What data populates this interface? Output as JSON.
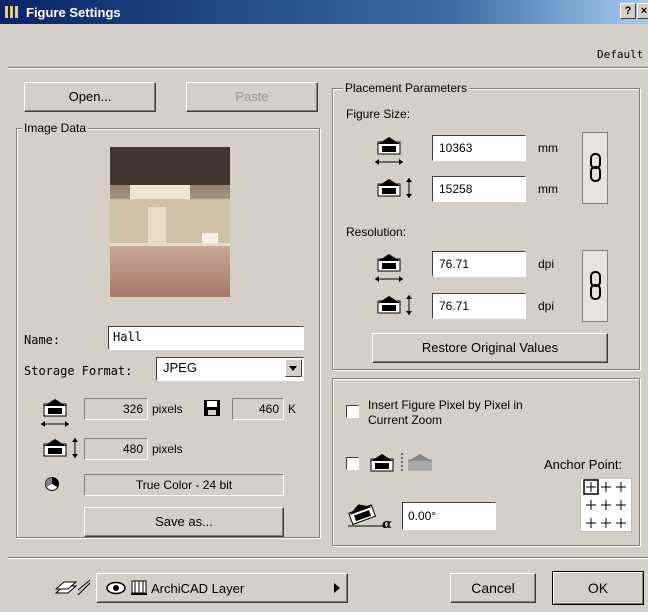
{
  "window": {
    "title": "Figure Settings",
    "help_label": "?",
    "close_label": "×"
  },
  "header": {
    "default_label": "Default"
  },
  "left": {
    "open_label": "Open...",
    "paste_label": "Paste",
    "image_data_label": "Image Data",
    "name_label": "Name:",
    "name_value": "Hall",
    "storage_label": "Storage Format:",
    "storage_value": "JPEG",
    "width_value": "326",
    "width_unit": "pixels",
    "size_value": "460",
    "size_unit": "K",
    "height_value": "480",
    "height_unit": "pixels",
    "color_value": "True Color - 24 bit",
    "save_as_label": "Save as..."
  },
  "placement": {
    "group_label": "Placement Parameters",
    "figure_size_label": "Figure Size:",
    "fig_width": "10363",
    "fig_height": "15258",
    "mm_unit": "mm",
    "resolution_label": "Resolution:",
    "res_h": "76.71",
    "res_v": "76.71",
    "dpi_unit": "dpi",
    "restore_label": "Restore Original Values"
  },
  "options": {
    "insert_pixel_label": "Insert Figure Pixel by Pixel in Current Zoom",
    "anchor_label": "Anchor Point:",
    "angle_value": "0.00°"
  },
  "footer": {
    "layer_label": "ArchiCAD Layer",
    "cancel_label": "Cancel",
    "ok_label": "OK"
  }
}
